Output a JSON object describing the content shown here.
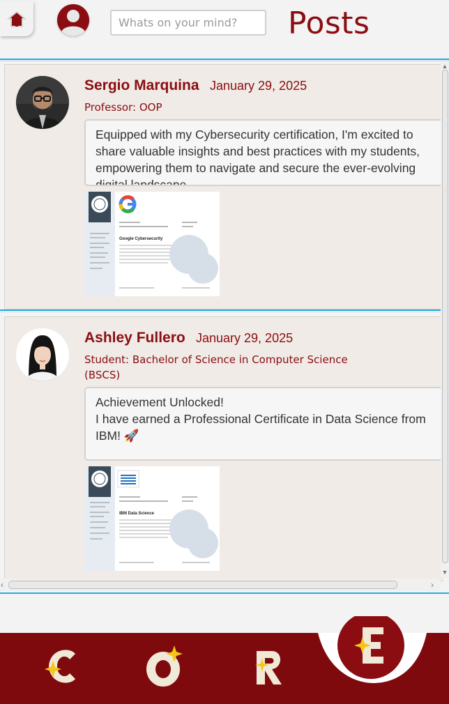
{
  "header": {
    "title": "Posts",
    "search_placeholder": "Whats on your mind?"
  },
  "posts": [
    {
      "author": "Sergio Marquina",
      "date": "January 29, 2025",
      "role": "Professor: OOP",
      "content": "Equipped with my Cybersecurity certification, I'm excited to share valuable insights and best practices with my students, empowering them to navigate and secure the ever-evolving digital landscape.",
      "certificate": {
        "issuer": "Google",
        "title": "Google Cybersecurity"
      }
    },
    {
      "author": "Ashley Fullero",
      "date": "January 29, 2025",
      "role": "Student: Bachelor of Science in Computer Science (BSCS)",
      "content": "Achievement Unlocked!\nI have earned a Professional Certificate in Data Science from IBM! 🚀",
      "certificate": {
        "issuer": "IBM",
        "title": "IBM Data Science"
      }
    }
  ],
  "bottom_nav": {
    "items": [
      "C",
      "O",
      "R",
      "E"
    ],
    "active": "E"
  },
  "colors": {
    "brand": "#8b0d12",
    "nav_background": "#7f0a0e",
    "accent_line": "#2aa8d8",
    "card_background": "#f0ebe6",
    "star": "#f5c518"
  }
}
